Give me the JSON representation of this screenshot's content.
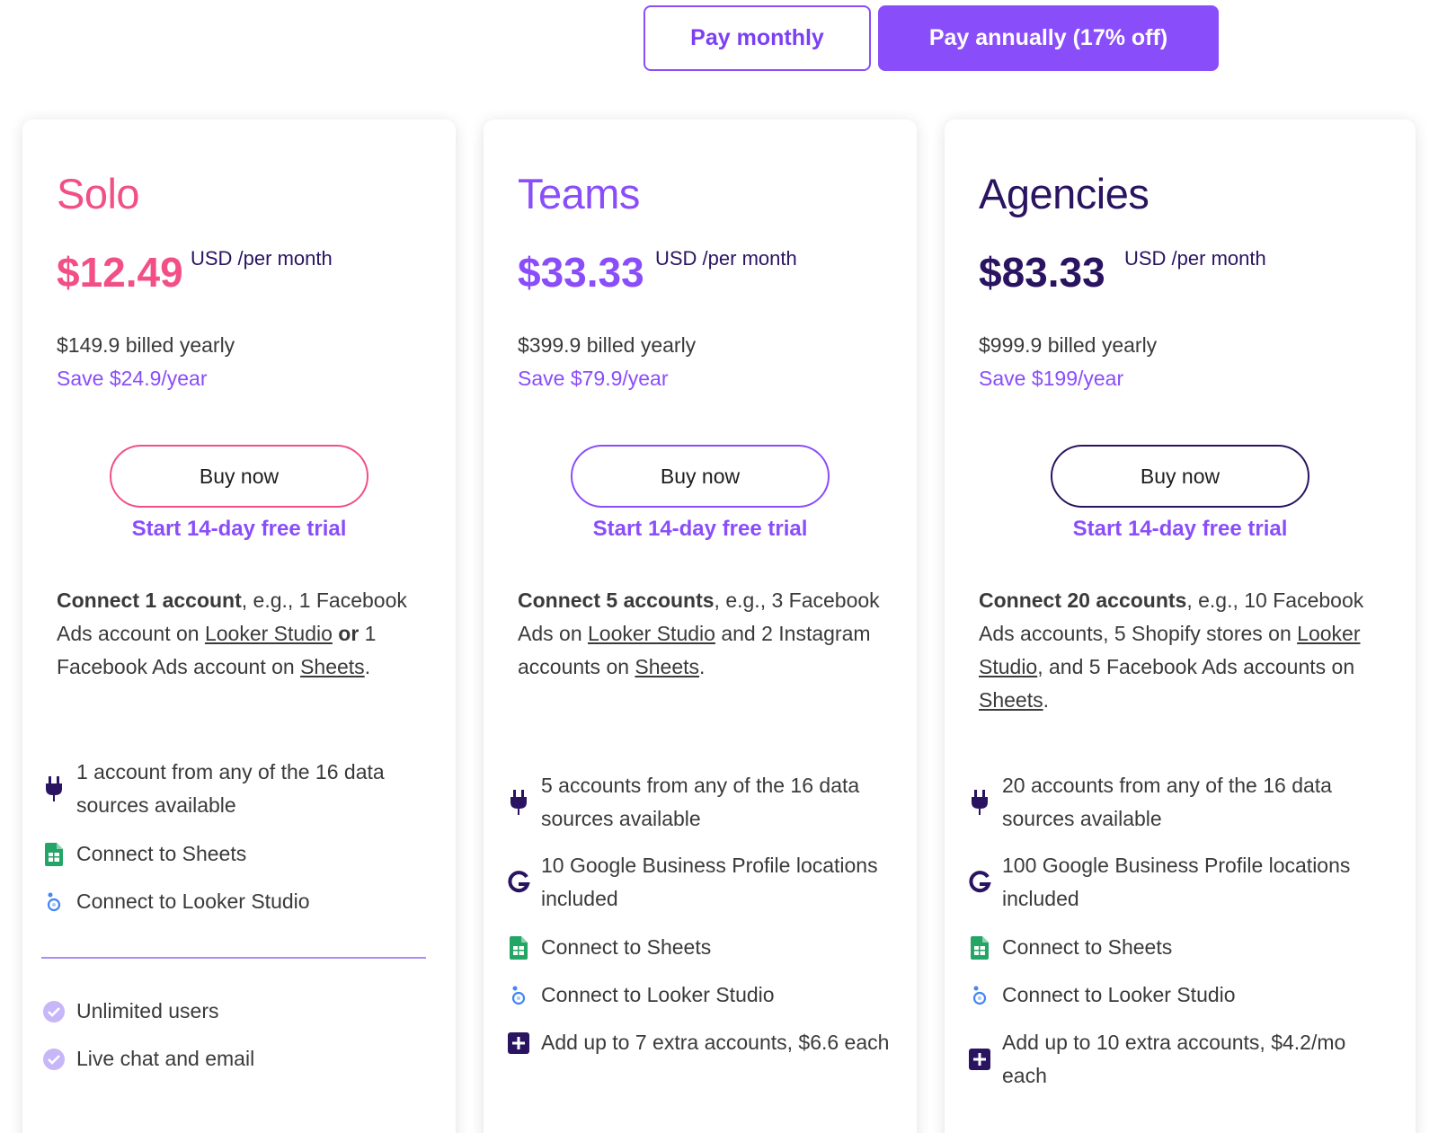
{
  "toggle": {
    "monthly_label": "Pay monthly",
    "annual_label": "Pay annually (17% off)"
  },
  "colors": {
    "accent_purple": "#8a4dfa",
    "solo_pink": "#f24f87",
    "agencies_navy": "#2a1461",
    "sheets_green": "#23a566",
    "looker_blue": "#4285f4"
  },
  "plans": {
    "solo": {
      "name": "Solo",
      "price": "$12.49",
      "price_unit": "USD /per month",
      "billed": "$149.9 billed yearly",
      "save": "Save $24.9/year",
      "buy_label": "Buy now",
      "trial_label": "Start 14-day free trial",
      "desc": {
        "bold": "Connect 1 account",
        "t1": ", e.g., 1 Facebook Ads account on ",
        "link1": "Looker Studio",
        "mid_bold": " or ",
        "t2": "1 Facebook Ads account on ",
        "link2": "Sheets",
        "end": "."
      },
      "features": [
        {
          "icon": "plug-icon",
          "text": "1 account from any of the 16 data sources available"
        },
        {
          "icon": "sheets-icon",
          "text": "Connect to Sheets"
        },
        {
          "icon": "looker-studio-icon",
          "text": "Connect to Looker Studio"
        }
      ],
      "extras": [
        {
          "icon": "check-circle-icon",
          "text": "Unlimited users"
        },
        {
          "icon": "check-circle-icon",
          "text": "Live chat and email"
        }
      ]
    },
    "teams": {
      "name": "Teams",
      "price": "$33.33",
      "price_unit": "USD /per month",
      "billed": "$399.9 billed yearly",
      "save": "Save $79.9/year",
      "buy_label": "Buy now",
      "trial_label": "Start 14-day free trial",
      "desc": {
        "bold": "Connect 5 accounts",
        "t1": ", e.g., 3 Facebook Ads on ",
        "link1": "Looker Studio",
        "t2": " and 2 Instagram accounts on ",
        "link2": "Sheets",
        "end": "."
      },
      "features": [
        {
          "icon": "plug-icon",
          "text": "5 accounts from any of the 16 data sources available"
        },
        {
          "icon": "google-g-icon",
          "text": "10 Google Business Profile locations included"
        },
        {
          "icon": "sheets-icon",
          "text": "Connect to Sheets"
        },
        {
          "icon": "looker-studio-icon",
          "text": "Connect to Looker Studio"
        },
        {
          "icon": "plus-square-icon",
          "text": "Add up to 7 extra accounts, $6.6 each"
        }
      ]
    },
    "agencies": {
      "name": "Agencies",
      "price": "$83.33",
      "price_unit": "USD /per month",
      "billed": "$999.9 billed yearly",
      "save": "Save $199/year",
      "buy_label": "Buy now",
      "trial_label": "Start 14-day free trial",
      "desc": {
        "bold": "Connect 20 accounts",
        "t1": ", e.g., 10 Facebook Ads accounts, 5 Shopify stores on ",
        "link1": "Looker Studio",
        "t2": ", and 5 Facebook Ads accounts on ",
        "link2": "Sheets",
        "end": "."
      },
      "features": [
        {
          "icon": "plug-icon",
          "text": "20 accounts from any of the 16 data sources available"
        },
        {
          "icon": "google-g-icon",
          "text": "100 Google Business Profile locations included"
        },
        {
          "icon": "sheets-icon",
          "text": "Connect to Sheets"
        },
        {
          "icon": "looker-studio-icon",
          "text": "Connect to Looker Studio"
        },
        {
          "icon": "plus-square-icon",
          "text": "Add up to 10 extra accounts, $4.2/mo each"
        }
      ]
    }
  }
}
